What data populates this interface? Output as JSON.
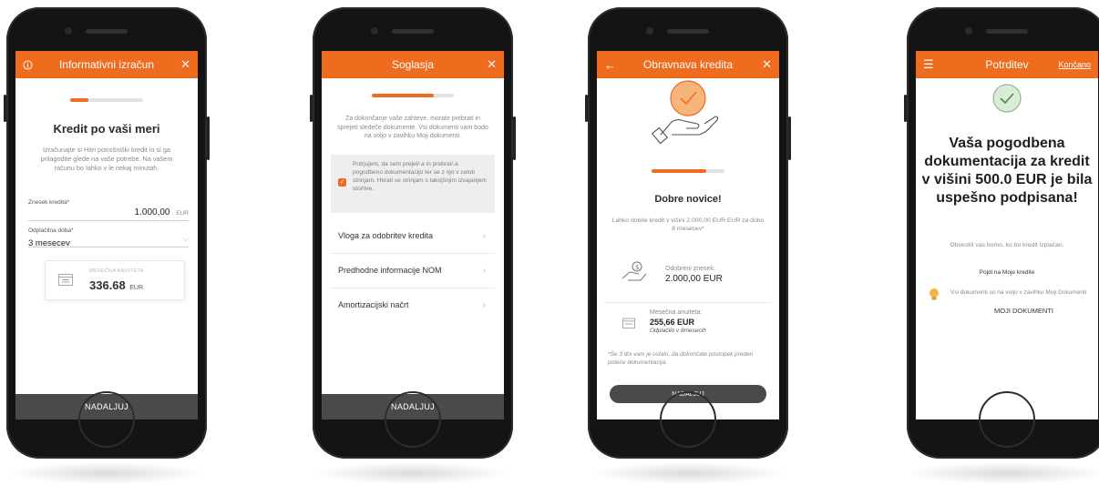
{
  "colors": {
    "accent": "#ef6c1f",
    "dark_button": "#4a4a4a",
    "phone_body": "#141414"
  },
  "screen1": {
    "title": "Informativni izračun",
    "progress": 0.25,
    "heading": "Kredit po vaši meri",
    "description": "Izračunajte si Hitri potrošniški kredit in si ga prilagodite glede na vaše potrebe. Na vašem računu bo lahko v le nekaj minutah.",
    "amount_label": "Znesek kredita*",
    "amount_value": "1.000,00",
    "amount_currency": "EUR",
    "term_label": "Odplačilna doba*",
    "term_value": "3 mesecev",
    "annuity_label": "MESEČNA ANUITETA",
    "annuity_value": "336.68",
    "annuity_currency": "EUR",
    "button": "NADALJUJ"
  },
  "screen2": {
    "title": "Soglasja",
    "progress": 0.75,
    "description": "Za dokončanje vaše zahteve, morate prebrati in sprejeti sledeče dokumente. Vsi dokumenti vam bodo na voljo v zavihku Moji dokumenti.",
    "consent_text": "Potrjujem, da sem prejel/-a in prebral/-a pogodbeno dokumentacijo ter se z njo v celoti strinjam. Hkrati se strinjam s takojšnjim izvajanjem storitve.",
    "documents": [
      {
        "label": "Vloga za odobritev kredita"
      },
      {
        "label": "Predhodne informacije NOM"
      },
      {
        "label": "Amortizacijski načrt"
      }
    ],
    "button": "NADALJUJ"
  },
  "screen3": {
    "title": "Obravnava kredita",
    "progress": 0.75,
    "heading": "Dobre novice!",
    "description": "Lahko dobite kredit v višini 2.000,00 EUR EUR za dobo 8 mesecev*",
    "approved_label": "Odobreni znesek:",
    "approved_value": "2.000,00 EUR",
    "annuity_label": "Mesečna anuiteta:",
    "annuity_value": "255,66 EUR",
    "annuity_note": "Odplačilo v 8mesecih",
    "footnote": "*Še 3 dni vam je ostalo, da dokončate postopek preden poteče dokumentacija.",
    "button": "NADALJUJ"
  },
  "screen4": {
    "title": "Potrditev",
    "done_link": "Končano",
    "heading": "Vaša pogodbena dokumentacija za kredit v višini 500.0 EUR je bila uspešno podpisana!",
    "notice": "Obvestili vas bomo, ko bo kredit izplačan.",
    "link_my_loans": "Pojdi na Moje kredite",
    "docs_hint": "Vsi dokumenti so na voljo v zavihku Moji Dokumenti",
    "docs_link": "MOJI DOKUMENTI"
  },
  "icons": [
    "info-icon",
    "close-icon",
    "back-arrow-icon",
    "menu-icon",
    "calendar-icon",
    "checkmark-icon",
    "hand-icon",
    "money-hand-icon",
    "lightbulb-icon",
    "chevron-right-icon"
  ]
}
